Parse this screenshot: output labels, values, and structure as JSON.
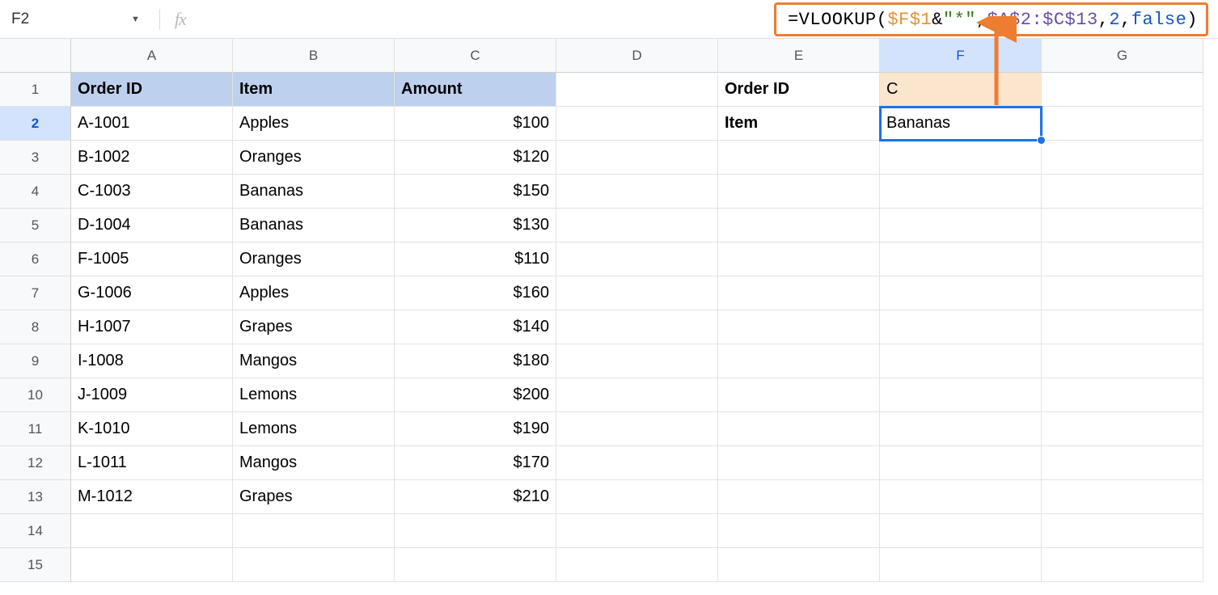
{
  "namebox": {
    "value": "F2"
  },
  "fx_label": "fx",
  "formula": {
    "p1": "=VLOOKUP(",
    "p2": "$F$1",
    "p3": "&",
    "p4": "\"*\"",
    "p5": ",",
    "p6": "$A$2:$C$13",
    "p7": ",",
    "p8": "2",
    "p9": ",",
    "p10": "false",
    "p11": ")"
  },
  "columns": [
    "A",
    "B",
    "C",
    "D",
    "E",
    "F",
    "G"
  ],
  "active_column_index": 5,
  "rows": [
    "1",
    "2",
    "3",
    "4",
    "5",
    "6",
    "7",
    "8",
    "9",
    "10",
    "11",
    "12",
    "13",
    "14",
    "15"
  ],
  "active_row_index": 1,
  "headers": {
    "order_id": "Order ID",
    "item": "Item",
    "amount": "Amount"
  },
  "data_rows": [
    {
      "id": "A-1001",
      "item": "Apples",
      "amount": "$100"
    },
    {
      "id": "B-1002",
      "item": "Oranges",
      "amount": "$120"
    },
    {
      "id": "C-1003",
      "item": "Bananas",
      "amount": "$150"
    },
    {
      "id": "D-1004",
      "item": "Bananas",
      "amount": "$130"
    },
    {
      "id": "F-1005",
      "item": "Oranges",
      "amount": "$110"
    },
    {
      "id": "G-1006",
      "item": "Apples",
      "amount": "$160"
    },
    {
      "id": "H-1007",
      "item": "Grapes",
      "amount": "$140"
    },
    {
      "id": "I-1008",
      "item": "Mangos",
      "amount": "$180"
    },
    {
      "id": "J-1009",
      "item": "Lemons",
      "amount": "$200"
    },
    {
      "id": "K-1010",
      "item": "Lemons",
      "amount": "$190"
    },
    {
      "id": "L-1011",
      "item": "Mangos",
      "amount": "$170"
    },
    {
      "id": "M-1012",
      "item": "Grapes",
      "amount": "$210"
    }
  ],
  "lookup": {
    "label_order_id": "Order ID",
    "label_item": "Item",
    "input_value": "C",
    "result_value": "Bananas"
  },
  "colors": {
    "annotation": "#ed7d31"
  }
}
